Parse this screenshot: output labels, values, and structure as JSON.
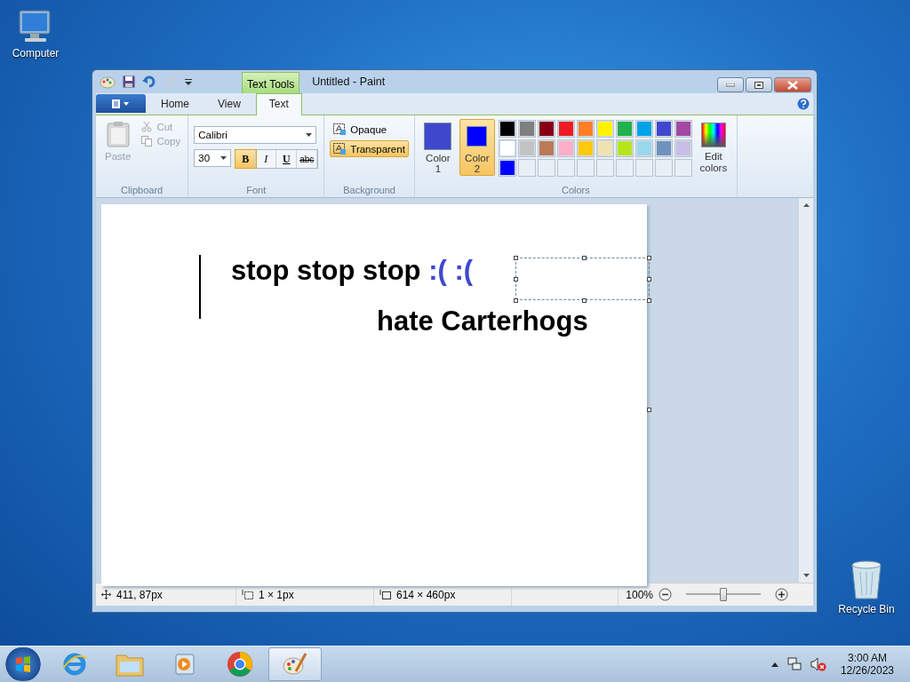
{
  "desktop_icons": [
    {
      "label": "Computer",
      "kind": "computer"
    },
    {
      "label": "Recycle Bin",
      "kind": "bin"
    }
  ],
  "window": {
    "title": "Untitled - Paint",
    "context_tab": "Text Tools"
  },
  "tabs": [
    {
      "label": "Home",
      "selected": false
    },
    {
      "label": "View",
      "selected": false
    },
    {
      "label": "Text",
      "selected": true
    }
  ],
  "clipboard": {
    "paste": "Paste",
    "cut": "Cut",
    "copy": "Copy",
    "label": "Clipboard"
  },
  "font": {
    "family": "Calibri",
    "size": "30",
    "label": "Font",
    "styles": [
      {
        "kind": "bold",
        "label": "B",
        "selected": true
      },
      {
        "kind": "italic",
        "label": "I",
        "selected": false
      },
      {
        "kind": "underline",
        "label": "U",
        "selected": false
      },
      {
        "kind": "strike",
        "label": "abc",
        "selected": false
      }
    ]
  },
  "background": {
    "label": "Background",
    "options": [
      {
        "label": "Opaque",
        "selected": false
      },
      {
        "label": "Transparent",
        "selected": true
      }
    ]
  },
  "colors": {
    "label": "Colors",
    "edit": "Edit colors",
    "slots": [
      {
        "label": "Color 1",
        "color": "#3f48cc",
        "selected": false
      },
      {
        "label": "Color 2",
        "color": "#0000ff",
        "selected": true
      }
    ],
    "palette": [
      [
        {
          "color": "#000000"
        },
        {
          "color": "#7f7f7f"
        },
        {
          "color": "#880015"
        },
        {
          "color": "#ed1c24"
        },
        {
          "color": "#ff7f27"
        },
        {
          "color": "#fff200"
        },
        {
          "color": "#22b14c"
        },
        {
          "color": "#00a2e8"
        },
        {
          "color": "#3f48cc"
        },
        {
          "color": "#a349a4"
        }
      ],
      [
        {
          "color": "#ffffff"
        },
        {
          "color": "#c3c3c3"
        },
        {
          "color": "#b97a57"
        },
        {
          "color": "#ffaec9"
        },
        {
          "color": "#ffc90e"
        },
        {
          "color": "#efe4b0"
        },
        {
          "color": "#b5e61d"
        },
        {
          "color": "#99d9ea"
        },
        {
          "color": "#7092be"
        },
        {
          "color": "#c8bfe7"
        }
      ],
      [
        {
          "color": "#0000ff"
        },
        {
          "kind": "empty"
        },
        {
          "kind": "empty"
        },
        {
          "kind": "empty"
        },
        {
          "kind": "empty"
        },
        {
          "kind": "empty"
        },
        {
          "kind": "empty"
        },
        {
          "kind": "empty"
        },
        {
          "kind": "empty"
        },
        {
          "kind": "empty"
        }
      ]
    ]
  },
  "canvas_text": [
    {
      "segments": [
        {
          "text": "stop stop stop ",
          "color": "#000000"
        },
        {
          "text": ":( :(",
          "color": "#3f48cc"
        }
      ]
    },
    {
      "segments": [
        {
          "text": "hate Carterhogs",
          "color": "#000000"
        }
      ]
    }
  ],
  "status_bar": {
    "cursor": "411, 87px",
    "selection": "1 × 1px",
    "size": "614 × 460px",
    "zoom": "100%",
    "zoom_slider": {
      "level": 0.5
    }
  },
  "taskbar": {
    "time": "3:00 AM",
    "date": "12/26/2023"
  }
}
